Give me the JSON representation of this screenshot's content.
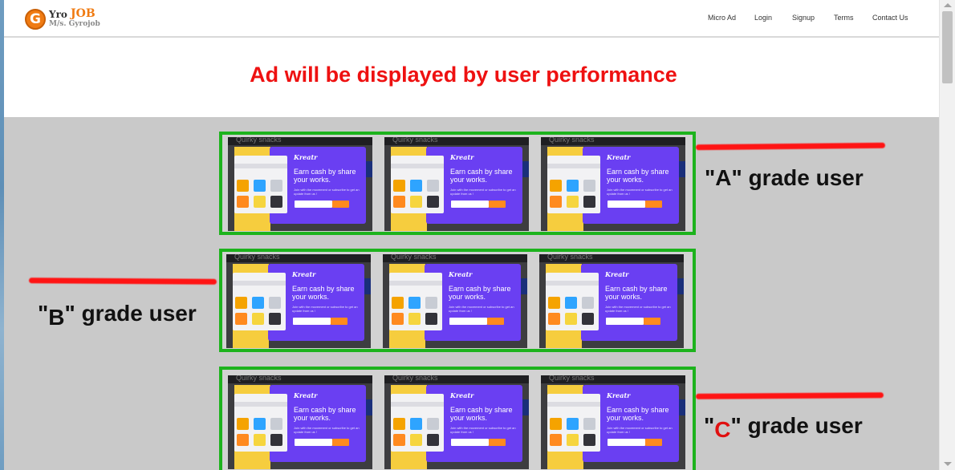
{
  "logo": {
    "mark": "G",
    "brand_part1": "Yro",
    "brand_part2": "JOB",
    "subtitle": "M/s. Gyrojob"
  },
  "nav": {
    "items": [
      {
        "label": "Micro Ad"
      },
      {
        "label": "Login"
      },
      {
        "label": "Signup"
      },
      {
        "label": "Terms"
      },
      {
        "label": "Contact Us"
      }
    ]
  },
  "heading": "Ad will be displayed by user performance",
  "ad": {
    "title": "Quirky snacks",
    "brand": "Kreatr",
    "headline": "Earn cash by share your works.",
    "subtext": "Join with the movement or subscribe to get an update from us !"
  },
  "grades": [
    {
      "open": "\"",
      "letter": "A",
      "close": "\" grade user"
    },
    {
      "open": "\"",
      "letter": "B",
      "close": "\" grade user"
    },
    {
      "open": "\"",
      "letter": "C",
      "close": "\" grade user"
    }
  ],
  "colors": {
    "heading": "#ee1111",
    "box_border": "#1db31d",
    "marker": "#ff1414",
    "ad_panel": "#6a3ff2",
    "ad_strip": "#f6cd3e",
    "ad_button": "#ff8a1f"
  }
}
